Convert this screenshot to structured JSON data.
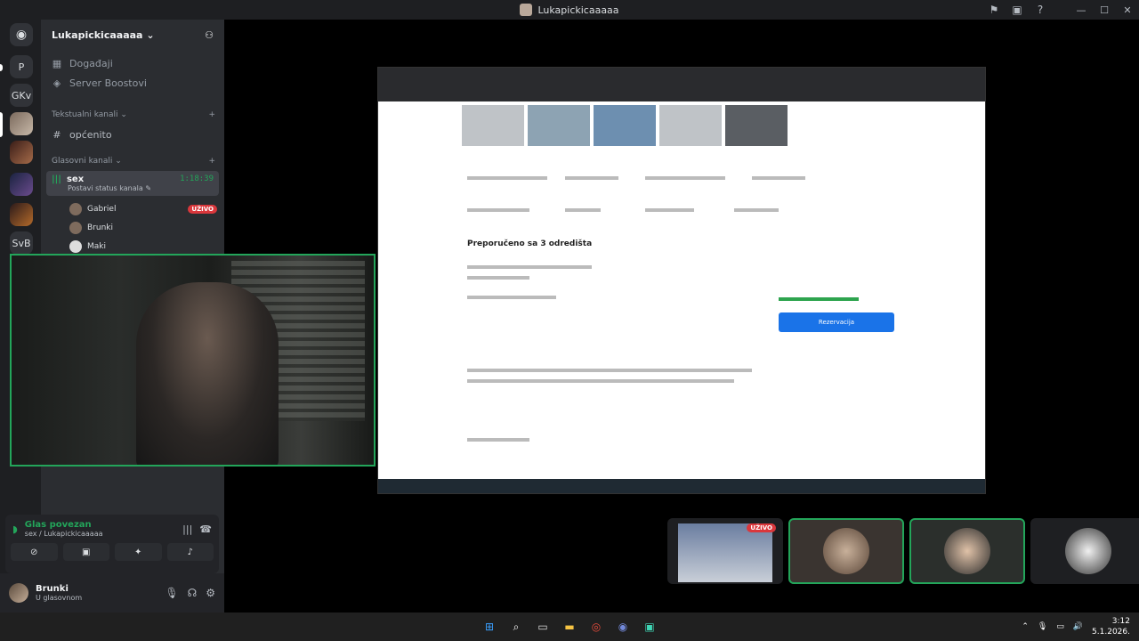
{
  "window": {
    "title": "Lukapickicaaaaa"
  },
  "servers": [
    {
      "label": "P"
    },
    {
      "label": "GKv"
    },
    {
      "label": "SvB"
    }
  ],
  "guild": {
    "name": "Lukapickicaaaaa",
    "items": [
      {
        "label": "Događaji",
        "icon": "calendar-icon"
      },
      {
        "label": "Server Boostovi",
        "icon": "boost-icon"
      }
    ],
    "text_category": "Tekstualni kanali",
    "text_channel": "općenito",
    "voice_category": "Glasovni kanali",
    "voice_channel": {
      "name": "sex",
      "time": "1:18:39",
      "status_hint": "Postavi status kanala"
    },
    "members": [
      {
        "name": "Gabriel",
        "live": "UŽIVO"
      },
      {
        "name": "Brunki"
      },
      {
        "name": "Maki"
      }
    ]
  },
  "voice": {
    "status": "Glas povezan",
    "location": "sex / Lukapickicaaaaa"
  },
  "user": {
    "name": "Brunki",
    "status": "U glasovnom"
  },
  "stream": {
    "heading": "Preporučeno sa 3 odredišta",
    "button": "Rezervacija"
  },
  "thumbs": [
    {
      "type": "screen",
      "live": "UŽIVO"
    },
    {
      "type": "user",
      "speaking": true
    },
    {
      "type": "user",
      "speaking": true
    },
    {
      "type": "user",
      "speaking": false
    }
  ],
  "taskbar": {
    "time": "3:12",
    "date": "5.1.2026."
  },
  "colors": {
    "accent_green": "#23a55a",
    "live_red": "#da373c",
    "button_blue": "#1a73e8"
  }
}
